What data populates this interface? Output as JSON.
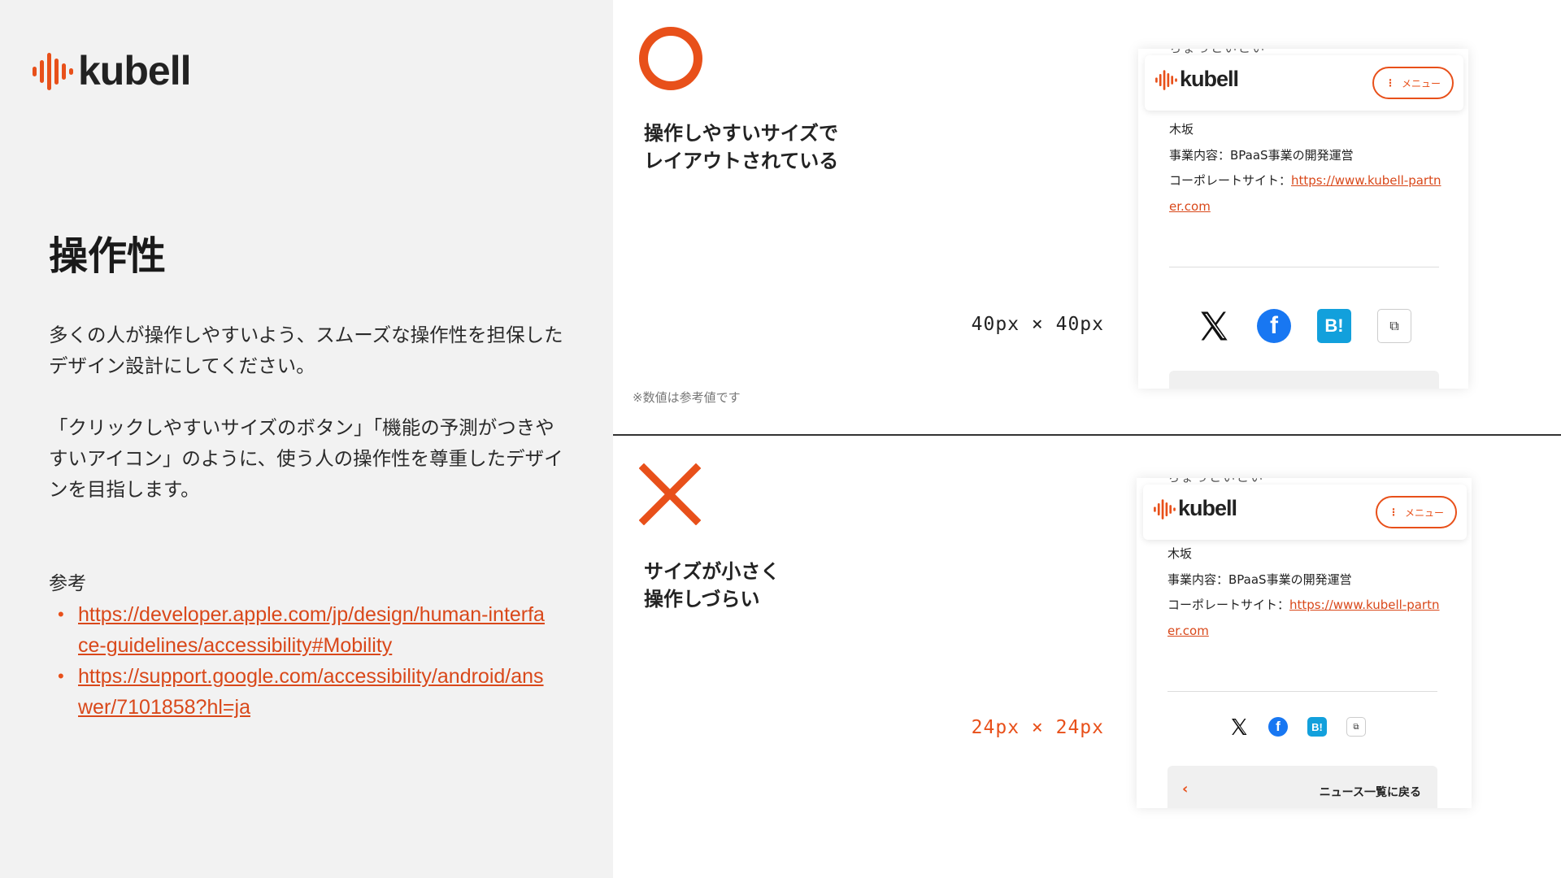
{
  "brand": {
    "name": "kubell",
    "accent_color": "#e8501a"
  },
  "left": {
    "title": "操作性",
    "para1": "多くの人が操作しやすいよう、スムーズな操作性を担保したデザイン設計にしてください。",
    "para2": "「クリックしやすいサイズのボタン」「機能の予測がつきやすいアイコン」のように、使う人の操作性を尊重したデザインを目指します。",
    "reference_label": "参考",
    "references": [
      "https://developer.apple.com/jp/design/human-interface-guidelines/accessibility#Mobility",
      "https://support.google.com/accessibility/android/answer/7101858?hl=ja"
    ]
  },
  "good": {
    "mark_icon": "circle-icon",
    "caption_line1": "操作しやすいサイズで",
    "caption_line2": "レイアウトされている",
    "size_label": "40px × 40px"
  },
  "bad": {
    "mark_icon": "cross-icon",
    "caption_line1": "サイズが小さく",
    "caption_line2": "操作しづらい",
    "size_label": "24px × 24px"
  },
  "note": "※数値は参考値です",
  "mockup": {
    "clipped_text": "ちょっといこい",
    "menu_label": "メニュー",
    "line_name": "木坂",
    "line_business": "事業内容：BPaaS事業の開発運営",
    "line_site_label": "コーポレートサイト：",
    "site_url": "https://www.kubell-partner.com",
    "share_icons": [
      "x-icon",
      "facebook-icon",
      "hatena-bookmark-icon",
      "copy-icon"
    ],
    "hatena_label": "B!",
    "back_label": "ニュース一覧に戻る",
    "back_icon": "chevron-left-icon"
  }
}
